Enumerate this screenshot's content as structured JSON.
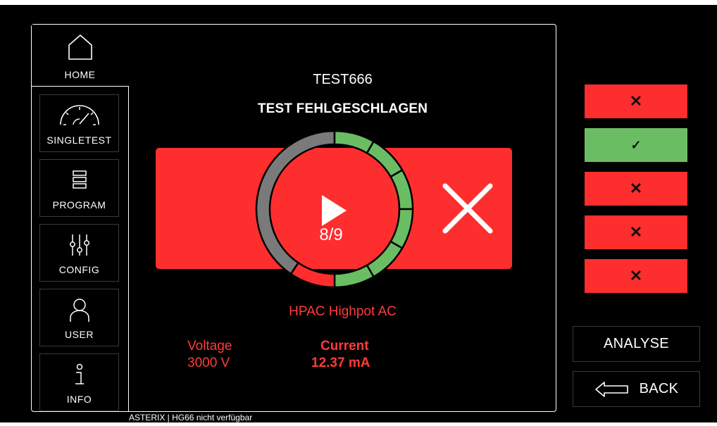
{
  "nav": {
    "home": {
      "label": "HOME",
      "icon": "home-icon"
    },
    "singletest": {
      "label": "SINGLETEST",
      "icon": "gauge-icon"
    },
    "program": {
      "label": "PROGRAM",
      "icon": "list-icon"
    },
    "config": {
      "label": "CONFIG",
      "icon": "sliders-icon"
    },
    "user": {
      "label": "USER",
      "icon": "user-icon"
    },
    "info": {
      "label": "INFO",
      "icon": "info-icon"
    }
  },
  "test": {
    "program_name": "TEST666",
    "result_text": "TEST FEHLGESCHLAGEN",
    "progress_label": "8/9",
    "completed_steps": 8,
    "total_steps": 9,
    "step_name": "HPAC Highpot AC"
  },
  "measurements": {
    "voltage_label": "Voltage",
    "voltage_value": "3000 V",
    "current_label": "Current",
    "current_value": "12.37 mA"
  },
  "results": [
    {
      "status": "fail",
      "symbol": "✕"
    },
    {
      "status": "pass",
      "symbol": "✓"
    },
    {
      "status": "fail",
      "symbol": "✕"
    },
    {
      "status": "fail",
      "symbol": "✕"
    },
    {
      "status": "fail",
      "symbol": "✕"
    }
  ],
  "buttons": {
    "analyse": "ANALYSE",
    "back": "BACK"
  },
  "status_bar": "ASTERIX | HG66 nicht verfügbar",
  "colors": {
    "fail": "#ff2e2e",
    "pass": "#6bbd64",
    "gauge_gray": "#7a7a7a"
  }
}
